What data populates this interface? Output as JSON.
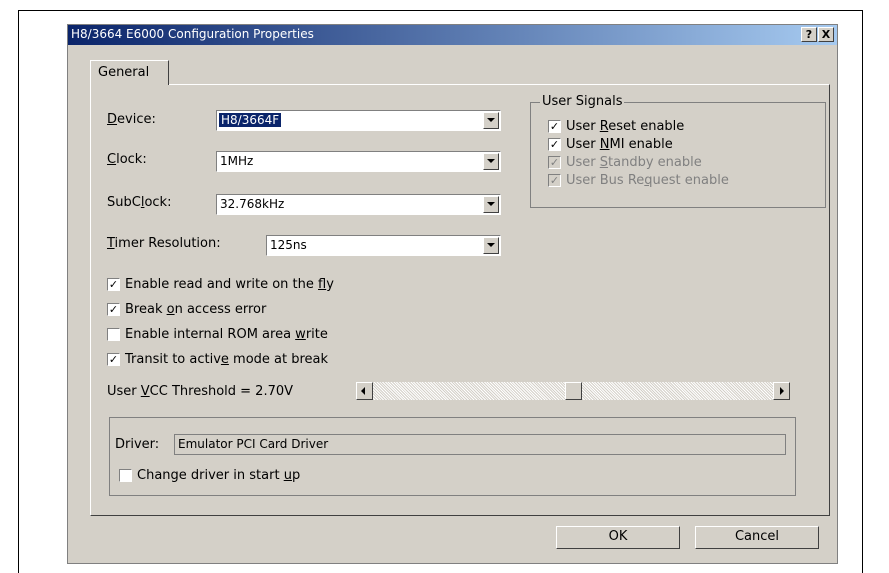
{
  "dialog": {
    "title": "H8/3664 E6000 Configuration Properties",
    "help_button": "?",
    "close_button": "X"
  },
  "tabs": [
    {
      "label": "General"
    }
  ],
  "general": {
    "device": {
      "label_pre": "",
      "label_u": "D",
      "label_post": "evice:",
      "value": "H8/3664F"
    },
    "clock": {
      "label_pre": "",
      "label_u": "C",
      "label_post": "lock:",
      "value": "1MHz"
    },
    "subclock": {
      "label_pre": "SubC",
      "label_u": "l",
      "label_post": "ock:",
      "value": "32.768kHz"
    },
    "timer_resolution": {
      "label_pre": "",
      "label_u": "T",
      "label_post": "imer Resolution:",
      "value": "125ns"
    },
    "options": [
      {
        "pre": "Enable read and write on the ",
        "u": "f",
        "post": "ly",
        "checked": true,
        "check_mark": "✓"
      },
      {
        "pre": "Break ",
        "u": "o",
        "post": "n access error",
        "checked": true,
        "check_mark": "✓"
      },
      {
        "pre": "Enable internal ROM area ",
        "u": "w",
        "post": "rite",
        "checked": false,
        "check_mark": ""
      },
      {
        "pre": "Transit to activ",
        "u": "e",
        "post": " mode at break",
        "checked": true,
        "check_mark": "✓"
      }
    ],
    "vcc": {
      "label_pre": "User ",
      "label_u": "V",
      "label_post": "CC Threshold = 2.70V",
      "slider_level": 0.5
    }
  },
  "user_signals": {
    "title": "User Signals",
    "items": [
      {
        "pre": "User ",
        "u": "R",
        "post": "eset enable",
        "checked": true,
        "enabled": true,
        "check_mark": "✓"
      },
      {
        "pre": "User ",
        "u": "N",
        "post": "MI enable",
        "checked": true,
        "enabled": true,
        "check_mark": "✓"
      },
      {
        "pre": "User ",
        "u": "S",
        "post": "tandby enable",
        "checked": true,
        "enabled": false,
        "check_mark": "✓"
      },
      {
        "pre": "User Bus Re",
        "u": "q",
        "post": "uest enable",
        "checked": true,
        "enabled": false,
        "check_mark": "✓"
      }
    ]
  },
  "driver": {
    "label": "Driver:",
    "value": "Emulator PCI Card Driver",
    "change": {
      "pre": "Change driver in start ",
      "u": "u",
      "post": "p",
      "checked": false,
      "check_mark": ""
    }
  },
  "buttons": {
    "ok": "OK",
    "cancel": "Cancel"
  },
  "colors": {
    "titlebar_start": "#0a246a",
    "titlebar_end": "#a6caf0",
    "face": "#d4d0c8",
    "selection": "#0a246a"
  }
}
